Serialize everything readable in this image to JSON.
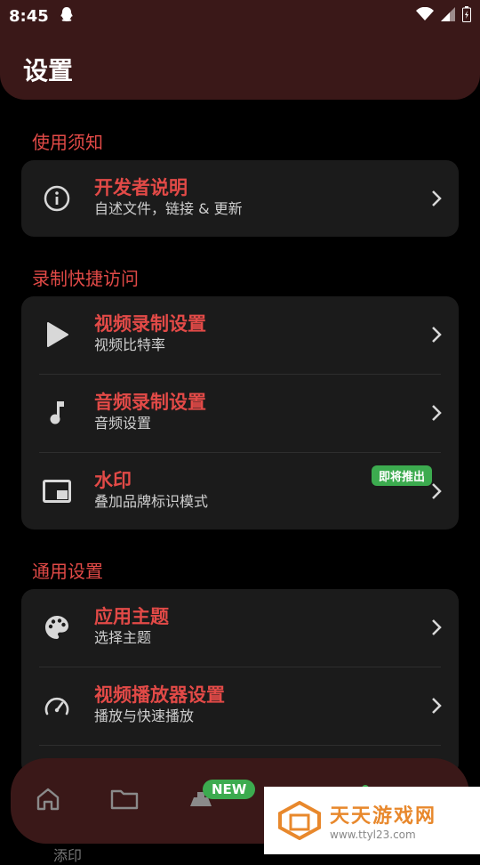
{
  "status_bar": {
    "time": "8:45"
  },
  "header": {
    "title": "设置"
  },
  "sections": {
    "usage": {
      "label": "使用须知",
      "items": [
        {
          "title": "开发者说明",
          "subtitle": "自述文件，链接 & 更新",
          "icon": "info-icon"
        }
      ]
    },
    "recording": {
      "label": "录制快捷访问",
      "items": [
        {
          "title": "视频录制设置",
          "subtitle": "视频比特率",
          "icon": "play-icon"
        },
        {
          "title": "音频录制设置",
          "subtitle": "音频设置",
          "icon": "music-note-icon"
        },
        {
          "title": "水印",
          "subtitle": "叠加品牌标识模式",
          "icon": "picture-in-picture-icon",
          "badge": "即将推出"
        }
      ]
    },
    "general": {
      "label": "通用设置",
      "items": [
        {
          "title": "应用主题",
          "subtitle": "选择主题",
          "icon": "palette-icon"
        },
        {
          "title": "视频播放器设置",
          "subtitle": "播放与快速播放",
          "icon": "speedometer-icon"
        }
      ]
    }
  },
  "bottom_nav": {
    "new_badge": "NEW",
    "items": [
      {
        "icon": "home-icon"
      },
      {
        "icon": "folder-icon"
      },
      {
        "icon": "record-icon"
      },
      {
        "icon": "settings-icon"
      }
    ]
  },
  "watermark": {
    "title": "天天游戏网",
    "url": "www.ttyl23.com"
  },
  "partial_text": "添印",
  "colors": {
    "accent": "#e24a47",
    "header_bg": "#3a1818",
    "card_bg": "#1b1b1b",
    "badge_green": "#3cab4f"
  }
}
